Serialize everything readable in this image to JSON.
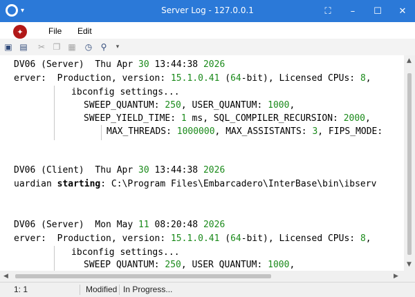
{
  "window": {
    "title": "Server Log - 127.0.0.1"
  },
  "menu": {
    "file": "File",
    "edit": "Edit"
  },
  "toolbar_icons": [
    "save-icon",
    "print-icon",
    "cut-icon",
    "copy-icon",
    "paste-icon",
    "history-icon",
    "zoom-icon"
  ],
  "log": {
    "block1": {
      "host": "DV06 (Server)",
      "date_dow": "Thu Apr",
      "date_day": "30",
      "date_time": "13:44:38",
      "date_year": "2026",
      "line1_prefix": "erver:  Production, version: ",
      "version": "15.1.0.41",
      "line1_mid1": " (",
      "bits": "64",
      "line1_mid2": "-bit), Licensed CPUs: ",
      "cpus": "8",
      "line1_tail": ",",
      "ibconfig": "ibconfig settings...",
      "sweep_label": "SWEEP_QUANTUM: ",
      "sweep_val": "250",
      "user_label": ", USER_QUANTUM: ",
      "user_val": "1000",
      "comma": ",",
      "yield_label": "SWEEP_YIELD_TIME: ",
      "yield_val": "1",
      "yield_unit": " ms, SQL_COMPILER_RECURSION: ",
      "recur_val": "2000",
      "threads_label": "MAX_THREADS: ",
      "threads_val": "1000000",
      "assist_label": ", MAX_ASSISTANTS: ",
      "assist_val": "3",
      "fips_label": ", FIPS_MODE:"
    },
    "block2": {
      "host": "DV06 (Client)",
      "date_dow": "Thu Apr",
      "date_day": "30",
      "date_time": "13:44:38",
      "date_year": "2026",
      "prefix": "uardian ",
      "keyword": "starting",
      "path": ": C:\\Program Files\\Embarcadero\\InterBase\\bin\\ibserv"
    },
    "block3": {
      "host": "DV06 (Server)",
      "date_dow": "Mon May",
      "date_day": "11",
      "date_time": "08:20:48",
      "date_year": "2026",
      "line1_prefix": "erver:  Production, version: ",
      "version": "15.1.0.41",
      "line1_mid1": " (",
      "bits": "64",
      "line1_mid2": "-bit), Licensed CPUs: ",
      "cpus": "8",
      "line1_tail": ",",
      "ibconfig": "ibconfig settings...",
      "sweep_label": "SWEEP QUANTUM: ",
      "sweep_val": "250",
      "user_label": ", USER QUANTUM: ",
      "user_val": "1000",
      "comma": ","
    }
  },
  "status": {
    "position": "1:  1",
    "state": "Modified",
    "progress": "In Progress..."
  }
}
